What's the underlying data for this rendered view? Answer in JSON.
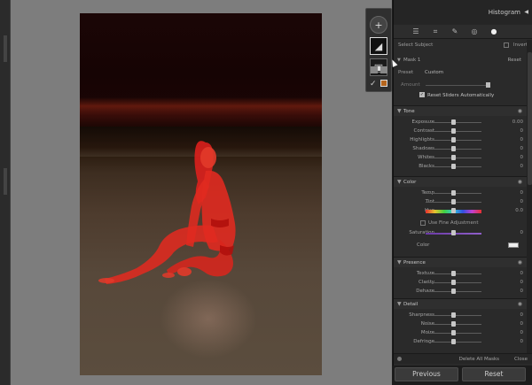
{
  "panel": {
    "histogram_label": "Histogram",
    "select_subject": "Select Subject",
    "invert": "Invert",
    "mask_name": "Mask 1",
    "mask_reset": "Reset",
    "preset_label": "Preset",
    "preset_value": "Custom",
    "amount_label": "Amount",
    "reset_sliders_auto": "Reset Sliders Automatically",
    "sections": {
      "tone": "Tone",
      "color": "Color",
      "presence": "Presence",
      "detail": "Detail"
    },
    "tone_sliders": [
      {
        "label": "Exposure",
        "value": "0.00",
        "level": 0.5
      },
      {
        "label": "Contrast",
        "value": "0",
        "level": 0.5
      },
      {
        "label": "Highlights",
        "value": "0",
        "level": 0.5
      },
      {
        "label": "Shadows",
        "value": "0",
        "level": 0.5
      },
      {
        "label": "Whites",
        "value": "0",
        "level": 0.5
      },
      {
        "label": "Blacks",
        "value": "0",
        "level": 0.5
      }
    ],
    "color_sliders": [
      {
        "label": "Temp",
        "value": "0",
        "level": 0.5
      },
      {
        "label": "Tint",
        "value": "0",
        "level": 0.5
      }
    ],
    "hue": {
      "label": "Hue",
      "value": "0.0",
      "level": 0.5
    },
    "use_fine_adjustment": "Use Fine Adjustment",
    "saturation": {
      "label": "Saturation",
      "value": "0",
      "level": 0.5
    },
    "color_label": "Color",
    "presence_sliders": [
      {
        "label": "Texture",
        "value": "0",
        "level": 0.5
      },
      {
        "label": "Clarity",
        "value": "0",
        "level": 0.5
      },
      {
        "label": "Dehaze",
        "value": "0",
        "level": 0.5
      }
    ],
    "detail_sliders": [
      {
        "label": "Sharpness",
        "value": "0",
        "level": 0.5
      },
      {
        "label": "Noise",
        "value": "0",
        "level": 0.5
      },
      {
        "label": "Moire",
        "value": "0",
        "level": 0.5
      },
      {
        "label": "Defringe",
        "value": "0",
        "level": 0.5
      }
    ],
    "delete_all_masks": "Delete All Masks",
    "close": "Close"
  },
  "nav": {
    "previous": "Previous",
    "reset": "Reset"
  },
  "colors": {
    "mask_overlay": "#e0201c",
    "canvas_bg": "#7d7d7d",
    "panel_bg": "#2a2a2a"
  },
  "icons": [
    "add-mask-icon",
    "mask-thumbnail-icon",
    "edit-sliders-icon",
    "crop-icon",
    "heal-icon",
    "red-eye-icon",
    "masking-icon",
    "eye-icon",
    "collapse-triangle-icon"
  ]
}
